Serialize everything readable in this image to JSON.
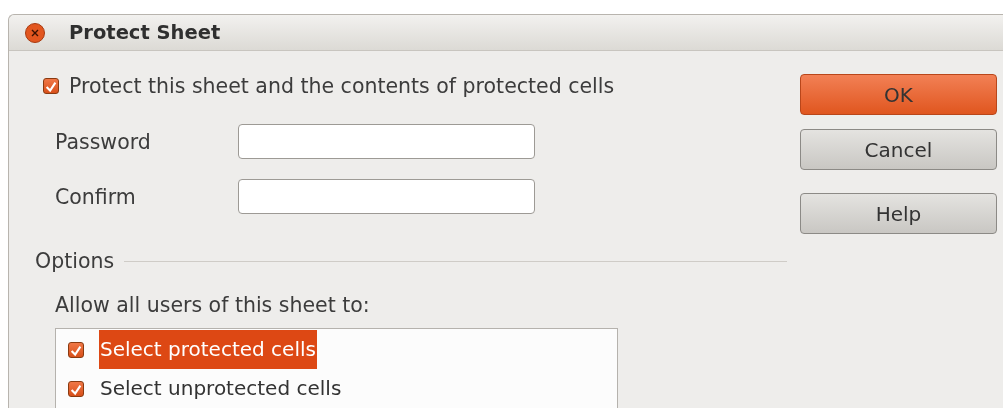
{
  "window": {
    "title": "Protect Sheet"
  },
  "protect": {
    "label": "Protect this sheet and the contents of protected cells",
    "checked": true
  },
  "fields": [
    {
      "label": "Password"
    },
    {
      "label": "Confirm"
    }
  ],
  "options": {
    "heading": "Options",
    "list_label": "Allow all users of this sheet to:",
    "items": [
      {
        "label": "Select protected cells",
        "checked": true,
        "selected": true
      },
      {
        "label": "Select unprotected cells",
        "checked": true,
        "selected": false
      }
    ]
  },
  "buttons": [
    {
      "label": "OK",
      "kind": "default"
    },
    {
      "label": "Cancel",
      "kind": "normal"
    },
    {
      "label": "Help",
      "kind": "normal"
    }
  ]
}
